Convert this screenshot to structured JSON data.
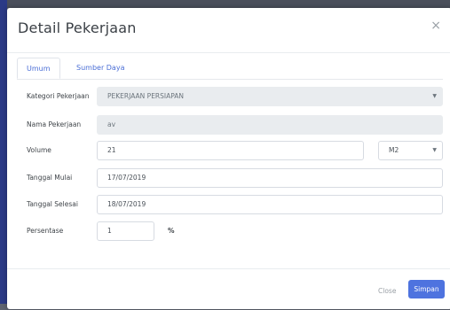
{
  "modal": {
    "title": "Detail Pekerjaan",
    "close_icon": "×",
    "tabs": [
      {
        "label": "Umum",
        "active": true
      },
      {
        "label": "Sumber Daya",
        "active": false
      }
    ],
    "fields": {
      "kategori": {
        "label": "Kategori Pekerjaan",
        "value": "PEKERJAAN PERSIAPAN"
      },
      "nama": {
        "label": "Nama Pekerjaan",
        "value": "av"
      },
      "volume": {
        "label": "Volume",
        "value": "21",
        "unit": "M2"
      },
      "tanggal_mulai": {
        "label": "Tanggal Mulai",
        "value": "17/07/2019"
      },
      "tanggal_selesai": {
        "label": "Tanggal Selesai",
        "value": "18/07/2019"
      },
      "persentase": {
        "label": "Persentase",
        "value": "1",
        "suffix": "%"
      }
    },
    "footer": {
      "close_label": "Close",
      "save_label": "Simpan"
    }
  },
  "colors": {
    "primary": "#4e73df",
    "backdrop": "#5f6470",
    "disabled_field": "#e9ecef"
  }
}
